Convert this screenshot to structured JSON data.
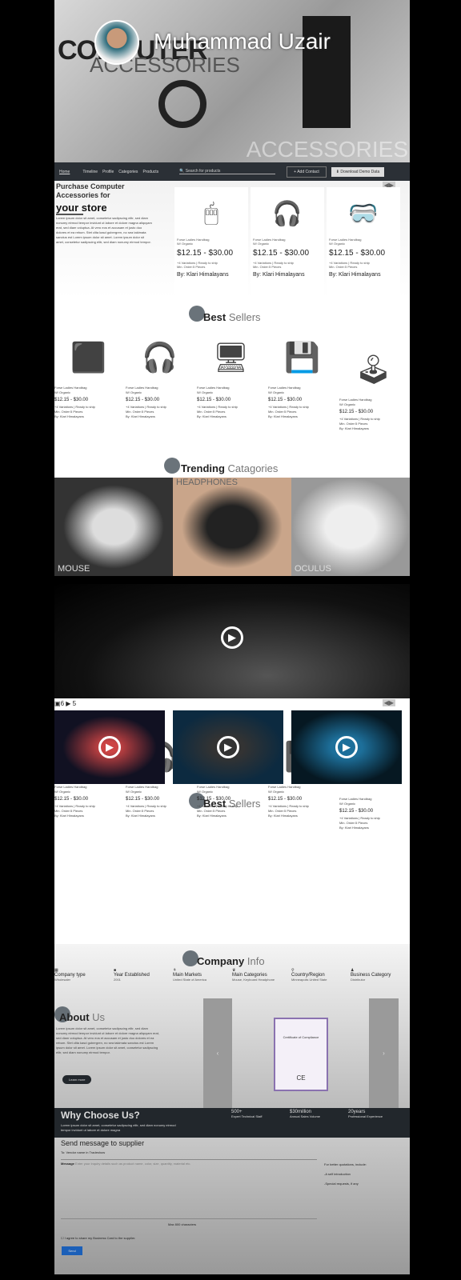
{
  "hero": {
    "title_big": "COMPUTER",
    "title_sub": "ACCESSORIES",
    "watermark": "ACCESSORIES",
    "user_name": "Muhammad Uzair"
  },
  "nav": {
    "items": [
      "Home",
      "Timeline",
      "Profile",
      "Categories",
      "Products"
    ],
    "search_placeholder": "Search for products",
    "add_contact": "+ Add Contact",
    "download": "Download Demo Data"
  },
  "purchase": {
    "heading": "Purchase Computer Accessories for",
    "heading_big": "your store",
    "body": "Lorem ipsum dolor sit amet, consetetur sadipscing elitr, sed diam nonumy eirmod tempor invidunt ut labore et dolore magna aliquyam erat, sed diam voluptua. At vero eos et accusam et justo duo dolores et ea rebum. Stet clita kasd gubergren, no sea takimata sanctus est Lorem ipsum dolor sit amet. Lorem ipsum dolor sit amet, consetetur sadipscing elitr, sed diam nonumy eirmod tempor.",
    "arrows": "◀▶",
    "products": [
      {
        "icon": "🖱",
        "name": "Forse Ladies Handbag",
        "sub": "W/ Organic",
        "price": "$12.15 - $30.00",
        "meta": "+4 Variations | Ready to ship",
        "min": "Min. Order:5 Pieces",
        "by": "By: Klari Himalayans"
      },
      {
        "icon": "🎧",
        "name": "Forse Ladies Handbag",
        "sub": "W/ Organic",
        "price": "$12.15 - $30.00",
        "meta": "+4 Variations | Ready to ship",
        "min": "Min. Order:5 Pieces",
        "by": "By: Klari Himalayans"
      },
      {
        "icon": "🥽",
        "name": "Forse Ladies Handbag",
        "sub": "W/ Organic",
        "price": "$12.15 - $30.00",
        "meta": "+4 Variations | Ready to ship",
        "min": "Min. Order:5 Pieces",
        "by": "By: Klari Himalayans"
      }
    ]
  },
  "best_sellers": {
    "title_a": "Best",
    "title_b": "Sellers",
    "items": [
      {
        "icon": "⬛",
        "name": "Forse Ladies Handbag",
        "sub": "W/ Organic",
        "price": "$12.15 - $30.00",
        "meta": "+4 Variations | Ready to ship",
        "min": "Min. Order:5 Pieces",
        "by": "By: Klari Himalayans"
      },
      {
        "icon": "🎧",
        "name": "Forse Ladies Handbag",
        "sub": "W/ Organic",
        "price": "$12.15 - $30.00",
        "meta": "+4 Variations | Ready to ship",
        "min": "Min. Order:5 Pieces",
        "by": "By: Klari Himalayans"
      },
      {
        "icon": "🖥",
        "name": "Forse Ladies Handbag",
        "sub": "W/ Organic",
        "price": "$12.15 - $30.00",
        "meta": "+4 Variations | Ready to ship",
        "min": "Min. Order:5 Pieces",
        "by": "By: Klari Himalayans"
      },
      {
        "icon": "💾",
        "name": "Forse Ladies Handbag",
        "sub": "W/ Organic",
        "price": "$12.15 - $30.00",
        "meta": "+4 Variations | Ready to ship",
        "min": "Min. Order:5 Pieces",
        "by": "By: Klari Himalayans"
      },
      {
        "icon": "🕹",
        "name": "Forse Ladies Handbag",
        "sub": "W/ Organic",
        "price": "$12.15 - $30.00",
        "meta": "+4 Variations | Ready to ship",
        "min": "Min. Order:5 Pieces",
        "by": "By: Klari Himalayans"
      }
    ]
  },
  "trending": {
    "title_a": "Trending",
    "title_b": "Catagories",
    "items": [
      "MOUSE",
      "HEADPHONES",
      "OCULUS"
    ]
  },
  "media": {
    "images": "6",
    "videos": "5",
    "arrows": "◀▶"
  },
  "company": {
    "title_a": "Company",
    "title_b": "Info",
    "fields": [
      {
        "icon": "▦",
        "label": "Company type",
        "value": "Wholesaler"
      },
      {
        "icon": "■",
        "label": "Year Established",
        "value": "2001"
      },
      {
        "icon": "⚘",
        "label": "Main Markets",
        "value": "United State of America"
      },
      {
        "icon": "♛",
        "label": "Main Categories",
        "value": "Mouse, Keyboard Headphone"
      },
      {
        "icon": "⚲",
        "label": "Country/Region",
        "value": "Minneapolis United State"
      },
      {
        "icon": "♟",
        "label": "Business Category",
        "value": "Distributor"
      }
    ]
  },
  "about": {
    "title_a": "About",
    "title_b": "Us",
    "body": "Lorem ipsum dolor sit amet, consetetur sadipscing elitr, sed diam nonumy eirmod tempor invidunt ut labore et dolore magna aliquyam erat, sed diam voluptua. At vero eos et accusam et justo duo dolores et ea rebum. Stet clita kasd gubergren, no sea takimata sanctus est Lorem ipsum dolor sit amet. Lorem ipsum dolor sit amet, consetetur sadipscing elitr, sed diam nonumy eirmod tempor.",
    "button": "Learn more",
    "cert_title": "Certificate of Compliance",
    "cert_mark": "CE"
  },
  "why": {
    "title": "Why Choose Us?",
    "body": "Lorem ipsum dolor sit amet, consetetur sadipscing elitr, sed diam nonumy eirmod tempor invidunt ut labore et dolore magna",
    "stats": [
      {
        "num": "500+",
        "label": "Expert Technical Staff"
      },
      {
        "num": "$30million",
        "label": "Annual Sales Volume"
      },
      {
        "num": "20years",
        "label": "Professional Experience"
      }
    ]
  },
  "send": {
    "title": "Send message to supplier",
    "to": "To: Vendor name in Tradeshow",
    "message_label": "Message",
    "placeholder": "Enter your inquiry details such as product name, color, size, quantity, material etc.",
    "counter": "Max 800 characters",
    "tips": [
      "For better quotations, include:",
      "-A self introduction",
      "-Special requests, if any"
    ],
    "agree": "I agree to share my Business Card to the supplier.",
    "button": "Send"
  }
}
